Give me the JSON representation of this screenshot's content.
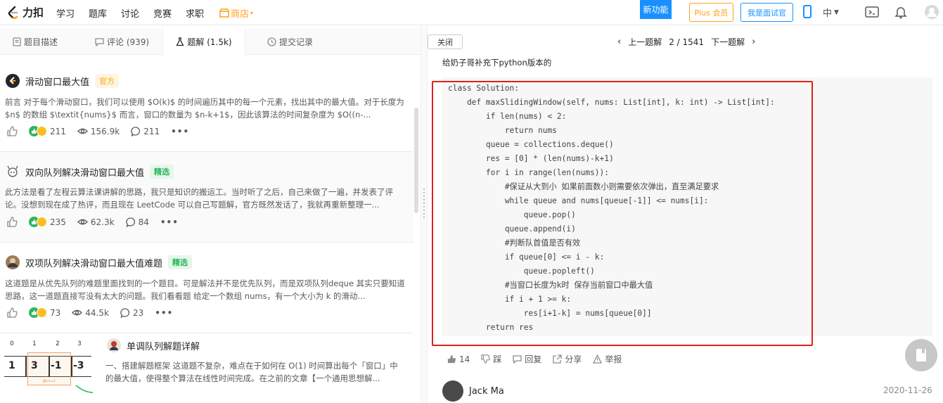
{
  "nav": {
    "logo_text": "力扣",
    "items": [
      "学习",
      "题库",
      "讨论",
      "竞赛",
      "求职"
    ],
    "store": "商店",
    "new_feature": "新功能",
    "plus": "Plus 会员",
    "interviewer": "我是面试官",
    "lang": "中"
  },
  "tabs": [
    {
      "label": "题目描述"
    },
    {
      "label": "评论 (939)"
    },
    {
      "label": "题解 (1.5k)"
    },
    {
      "label": "提交记录"
    }
  ],
  "solutions": [
    {
      "title": "滑动窗口最大值",
      "badge": "官方",
      "summary": "前言 对于每个滑动窗口，我们可以使用 $O(k)$ 的时间遍历其中的每一个元素，找出其中的最大值。对于长度为 $n$ 的数组 $\\textit{nums}$ 而言，窗口的数量为 $n-k+1$，因此该算法的时间复杂度为 $O((n-...",
      "reactions": "211",
      "views": "156.9k",
      "comments": "211"
    },
    {
      "title": "双向队列解决滑动窗口最大值",
      "badge": "精选",
      "summary": "此方法是看了左程云算法课讲解的思路，我只是知识的搬运工。当时听了之后，自己来做了一遍，并发表了评论。没想到现在成了热评，而且现在 LeetCode 可以自己写题解，官方既然发话了，我就再重新整理一...",
      "reactions": "235",
      "views": "62.3k",
      "comments": "84"
    },
    {
      "title": "双项队列解决滑动窗口最大值难题",
      "badge": "精选",
      "summary": "这道题是从优先队列的难题里面找到的一个题目。可是解法并不是优先队列，而是双项队列deque 其实只要知道思路，这一道题直接写没有太大的问题。我们看看题 给定一个数组 nums，有一个大小为 k 的滑动...",
      "reactions": "73",
      "views": "44.5k",
      "comments": "23"
    },
    {
      "title": "单调队列解题详解",
      "summary": "一、搭建解题框架 这道题不复杂，难点在于如何在 O(1) 时间算出每个「窗口」中的最大值，使得整个算法在线性时间完成。在之前的文章【一个通用思想解...",
      "diagram": {
        "indices": [
          "0",
          "1",
          "2",
          "3"
        ],
        "cells": [
          "1",
          "3",
          "-1",
          "-3"
        ],
        "caption": "窗口 k=3"
      }
    }
  ],
  "right": {
    "close": "关闭",
    "prev": "上一题解",
    "page": "2 / 1541",
    "next": "下一题解",
    "intro": "给奶子哥补充下python版本的",
    "code_lines": [
      "class Solution:",
      "    def maxSlidingWindow(self, nums: List[int], k: int) -> List[int]:",
      "        if len(nums) < 2:",
      "            return nums",
      "        queue = collections.deque()",
      "        res = [0] * (len(nums)-k+1)",
      "        for i in range(len(nums)):",
      "            #保证从大到小 如果前面数小则需要依次弹出，直至满足要求",
      "            while queue and nums[queue[-1]] <= nums[i]:",
      "                queue.pop()",
      "            queue.append(i)",
      "            #判断队首值是否有效",
      "            if queue[0] <= i - k:",
      "                queue.popleft()",
      "            #当窗口长度为k时 保存当前窗口中最大值",
      "            if i + 1 >= k:",
      "                res[i+1-k] = nums[queue[0]]",
      "        return res"
    ],
    "actions": {
      "likes": "14",
      "dislike": "踩",
      "reply": "回复",
      "share": "分享",
      "report": "举报"
    },
    "author": "Jack Ma",
    "date": "2020-11-26"
  }
}
